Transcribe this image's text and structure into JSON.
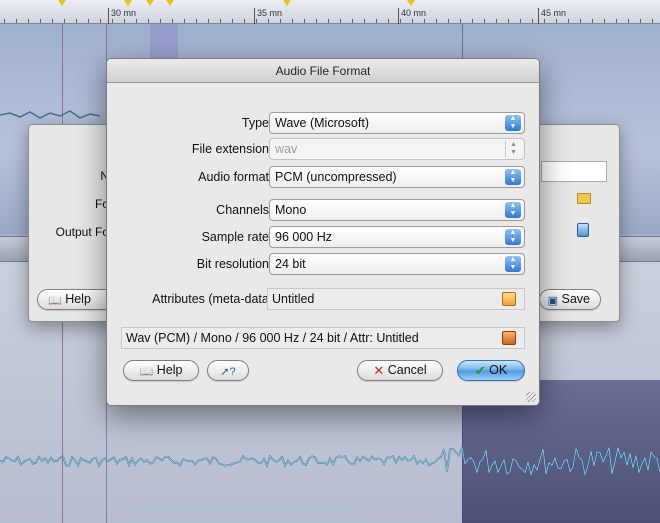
{
  "ruler": {
    "labels": [
      "30 mn",
      "35 mn",
      "40 mn",
      "45 mn"
    ]
  },
  "back_dialog": {
    "labels": [
      "N",
      "Fo",
      "Output Fo"
    ],
    "help_label": "Help",
    "save_label": "Save"
  },
  "dialog": {
    "title": "Audio File Format",
    "type_label": "Type",
    "type_value": "Wave (Microsoft)",
    "ext_label": "File extension",
    "ext_value": "wav",
    "audio_format_label": "Audio format",
    "audio_format_value": "PCM (uncompressed)",
    "channels_label": "Channels",
    "channels_value": "Mono",
    "sample_rate_label": "Sample rate",
    "sample_rate_value": "96 000 Hz",
    "bit_res_label": "Bit resolution",
    "bit_res_value": "24 bit",
    "attributes_label": "Attributes (meta-data)",
    "attributes_value": "Untitled",
    "summary": "Wav (PCM) / Mono / 96 000 Hz / 24 bit / Attr: Untitled",
    "help_label": "Help",
    "cancel_label": "Cancel",
    "ok_label": "OK"
  },
  "icons": {
    "popup_arrows": "up-down-arrows-icon",
    "help": "book-icon",
    "cancel": "x-icon",
    "ok": "checkmark-icon"
  },
  "colors": {
    "accent": "#4c98dd",
    "cancel_x": "#d0281e",
    "ok_check": "#1b9a2a",
    "marker": "#e6c21a",
    "waveform": "#8fdbe8"
  }
}
